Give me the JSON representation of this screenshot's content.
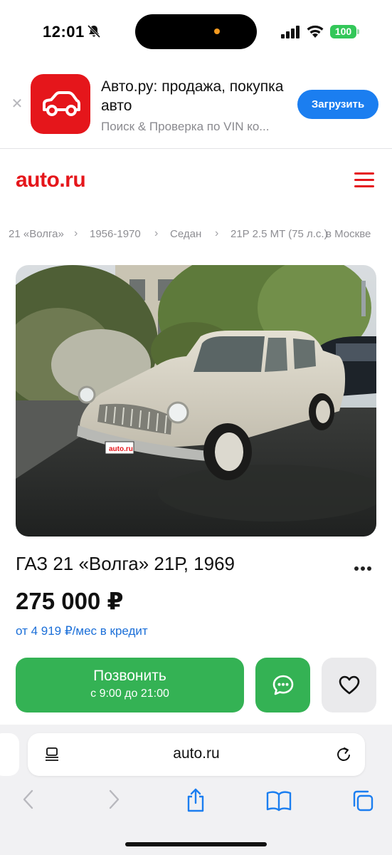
{
  "status_bar": {
    "time": "12:01",
    "battery": "100"
  },
  "app_banner": {
    "title": "Авто.ру: продажа, покупка авто",
    "subtitle": "Поиск & Проверка по VIN ко...",
    "button": "Загрузить"
  },
  "header": {
    "logo": "auto.ru"
  },
  "breadcrumbs": [
    "21 «Волга»",
    "1956-1970",
    "Седан",
    "21P 2.5 MT (75 л.с.)",
    "в Москве"
  ],
  "listing": {
    "title": "ГАЗ 21 «Волга» 21Р, 1969",
    "price": "275 000 ₽",
    "credit": "от 4 919 ₽/мес в кредит",
    "call_label": "Позвонить",
    "call_hours": "с 9:00 до 21:00",
    "plate_text": "auto.ru"
  },
  "browser": {
    "url": "auto.ru"
  },
  "colors": {
    "brand": "#e5161b",
    "call_green": "#34b254",
    "link_blue": "#1b6fd8",
    "banner_blue": "#1b7ef0"
  }
}
